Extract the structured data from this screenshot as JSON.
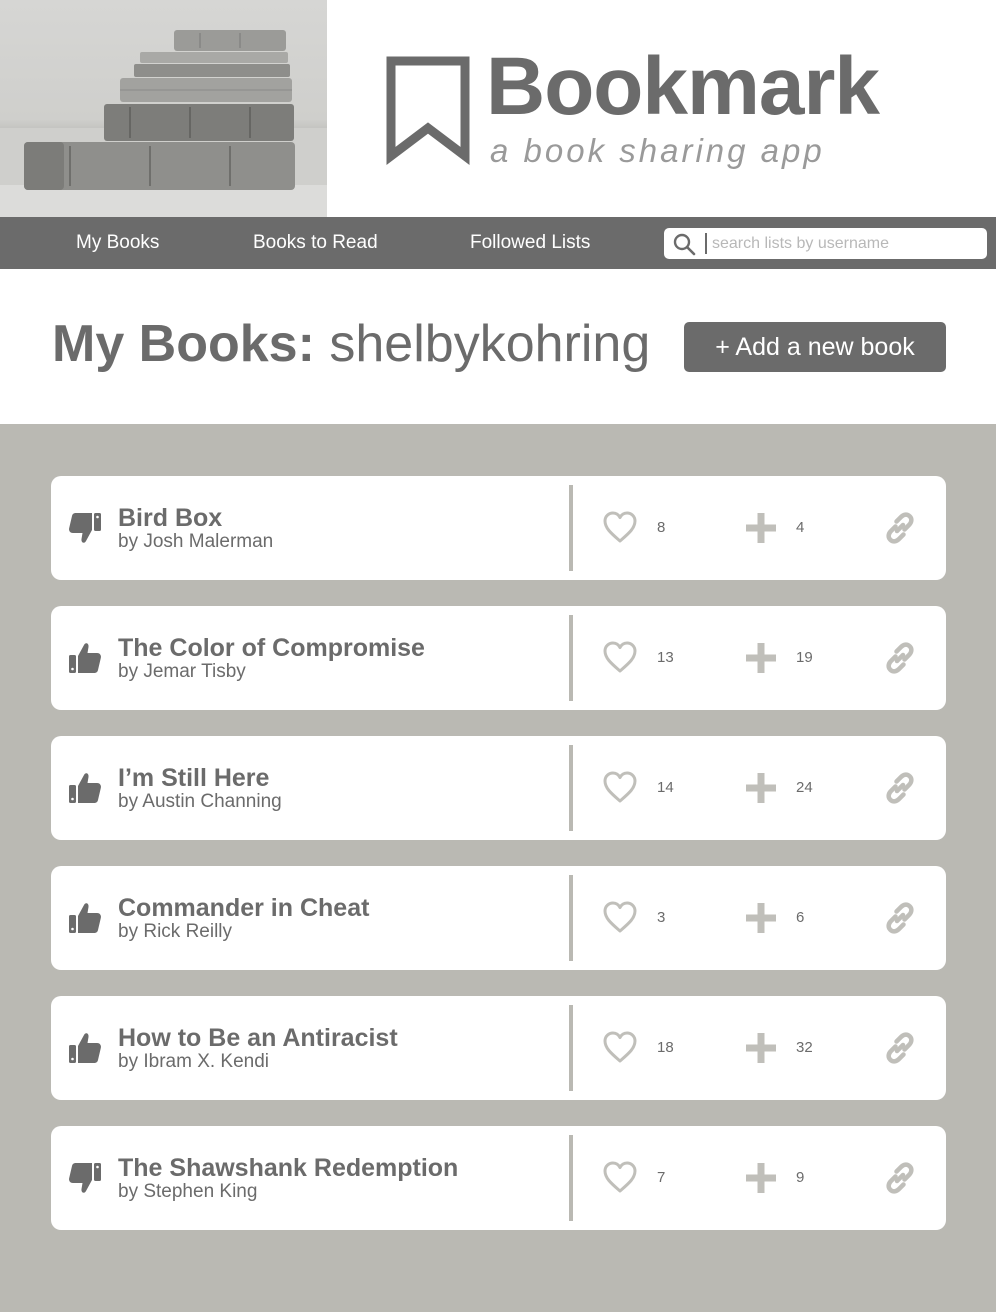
{
  "brand": {
    "title": "Bookmark",
    "tagline": "a book sharing app"
  },
  "nav": {
    "items": [
      {
        "label": "My Books"
      },
      {
        "label": "Books to Read"
      },
      {
        "label": "Followed Lists"
      }
    ],
    "search_placeholder": "search lists by username",
    "search_value": ""
  },
  "page": {
    "title_prefix": "My Books:",
    "username": "shelbykohring",
    "add_button_label": "+ Add a new book"
  },
  "colors": {
    "primary": "#6b6b6b",
    "background": "#bab9b3",
    "icon_light": "#c0bfba",
    "card": "#ffffff"
  },
  "books": [
    {
      "title": "Bird Box",
      "author": "by Josh Malerman",
      "rating": "thumbs-down",
      "likes": "8",
      "adds": "4"
    },
    {
      "title": "The Color of Compromise",
      "author": "by Jemar Tisby",
      "rating": "thumbs-up",
      "likes": "13",
      "adds": "19"
    },
    {
      "title": "I’m Still Here",
      "author": "by Austin Channing",
      "rating": "thumbs-up",
      "likes": "14",
      "adds": "24"
    },
    {
      "title": "Commander in Cheat",
      "author": "by Rick Reilly",
      "rating": "thumbs-up",
      "likes": "3",
      "adds": "6"
    },
    {
      "title": "How to Be an Antiracist",
      "author": "by Ibram X. Kendi",
      "rating": "thumbs-up",
      "likes": "18",
      "adds": "32"
    },
    {
      "title": "The Shawshank Redemption",
      "author": "by Stephen King",
      "rating": "thumbs-down",
      "likes": "7",
      "adds": "9"
    }
  ]
}
